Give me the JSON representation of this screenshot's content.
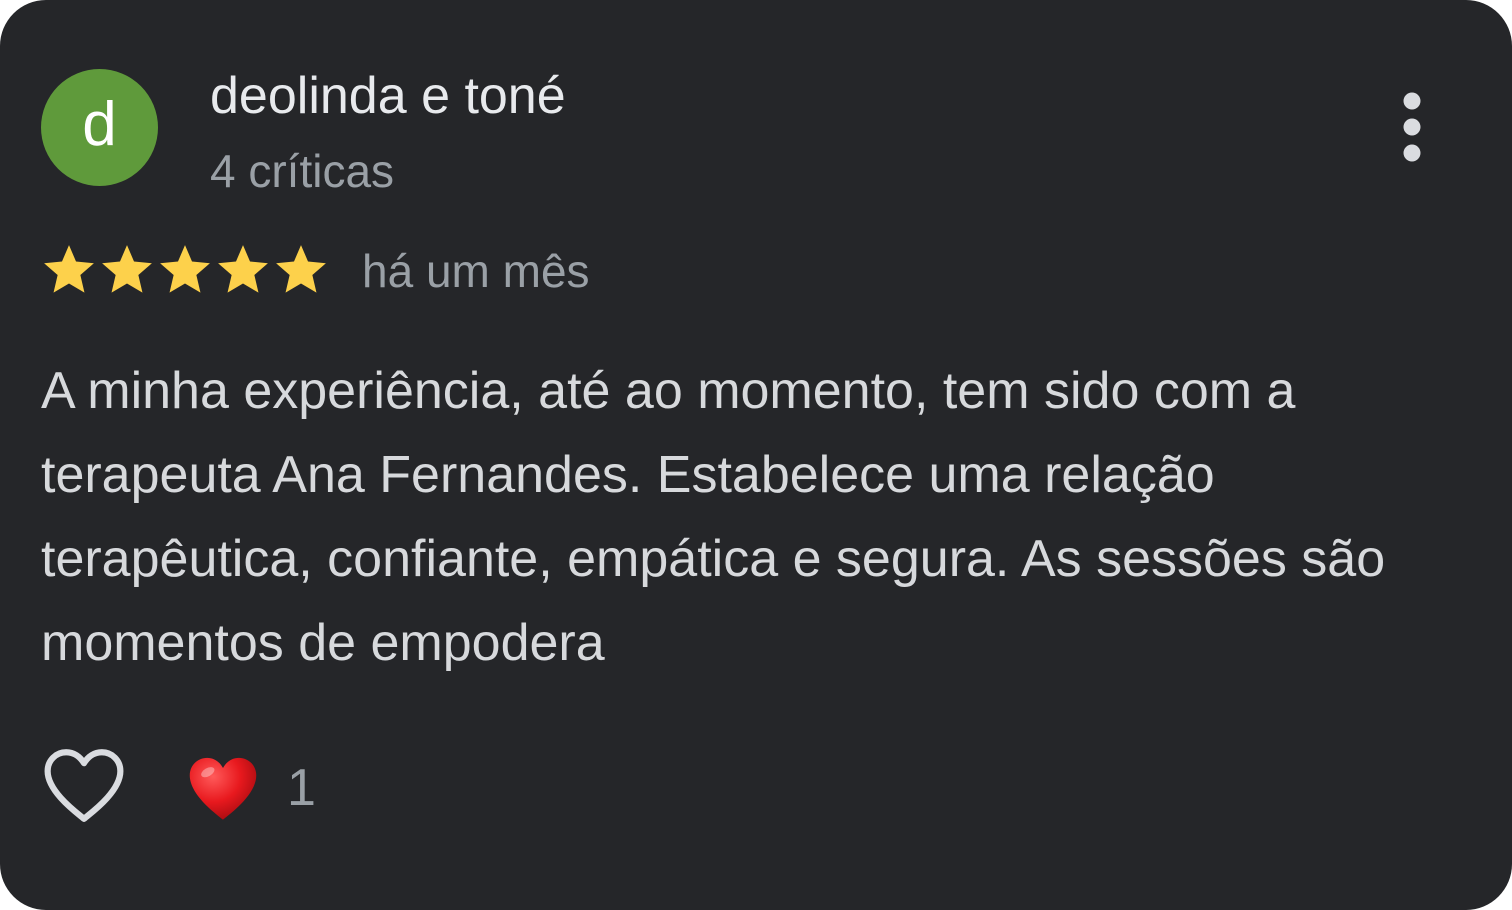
{
  "review": {
    "author": {
      "name": "deolinda e toné",
      "initial": "d",
      "avatar_color": "#5f9a3b",
      "review_count": "4 críticas"
    },
    "rating": 5,
    "rating_max": 5,
    "star_color": "#fdd14b",
    "date": "há um mês",
    "text": "A minha experiência, até ao momento, tem sido com a terapeuta Ana Fernandes. Estabelece uma relação terapêutica, confiante, empática e segura. As sessões são momentos de empodera",
    "actions": {
      "more_icon": "more-vertical-icon",
      "like_icon": "heart-outline-icon"
    },
    "reactions": {
      "icon": "red-heart-emoji-icon",
      "count": "1"
    }
  },
  "colors": {
    "card_background": "#252629",
    "primary_text": "#e8eaed",
    "secondary_text": "#9aa0a6",
    "body_text": "#d7d9dc"
  }
}
